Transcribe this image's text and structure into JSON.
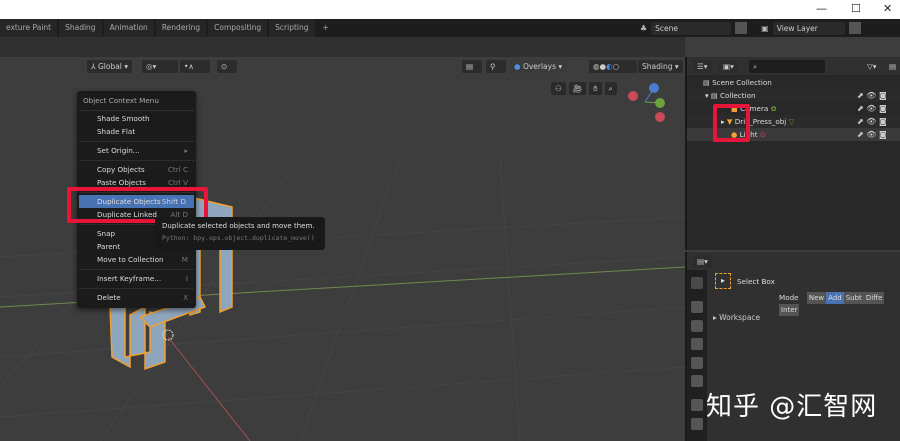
{
  "window_controls": {
    "minimize": "—",
    "maximize": "☐",
    "close": "✕"
  },
  "workspace_tabs": [
    "exture Paint",
    "Shading",
    "Animation",
    "Rendering",
    "Compositing",
    "Scripting",
    "+"
  ],
  "scene": {
    "scene_name": "Scene",
    "view_layer": "View Layer"
  },
  "viewport_header": {
    "orientation": "Global",
    "overlays": "Overlays",
    "shading": "Shading"
  },
  "context_menu": {
    "title": "Object Context Menu",
    "items": [
      {
        "label": "Shade Smooth",
        "shortcut": ""
      },
      {
        "label": "Shade Flat",
        "shortcut": ""
      },
      {
        "label": "Set Origin...",
        "shortcut": "▸"
      },
      {
        "label": "Copy Objects",
        "shortcut": "Ctrl C"
      },
      {
        "label": "Paste Objects",
        "shortcut": "Ctrl V"
      },
      {
        "label": "Duplicate Objects",
        "shortcut": "Shift D"
      },
      {
        "label": "Duplicate Linked",
        "shortcut": "Alt D"
      },
      {
        "label": "Snap",
        "shortcut": ""
      },
      {
        "label": "Parent",
        "shortcut": ""
      },
      {
        "label": "Move to Collection",
        "shortcut": "M"
      },
      {
        "label": "Insert Keyframe...",
        "shortcut": "I"
      },
      {
        "label": "Delete",
        "shortcut": "X"
      }
    ]
  },
  "tooltip": {
    "description": "Duplicate selected objects and move them.",
    "python": "Python: bpy.ops.object.duplicate_move()"
  },
  "outliner": {
    "scene_collection": "Scene Collection",
    "collection": "Collection",
    "objects": [
      "Camera",
      "Drill_Press_obj",
      "Light"
    ]
  },
  "properties": {
    "tool": "Select Box",
    "mode_label": "Mode",
    "modes": [
      "New",
      "Add",
      "Subt",
      "Diffe",
      "Inter"
    ],
    "active_mode": "Add",
    "panel": "Workspace"
  },
  "watermark": "知乎 @汇智网",
  "colors": {
    "highlight": "#4772b3",
    "annotation": "#e8153b",
    "selection": "#f0a030"
  }
}
